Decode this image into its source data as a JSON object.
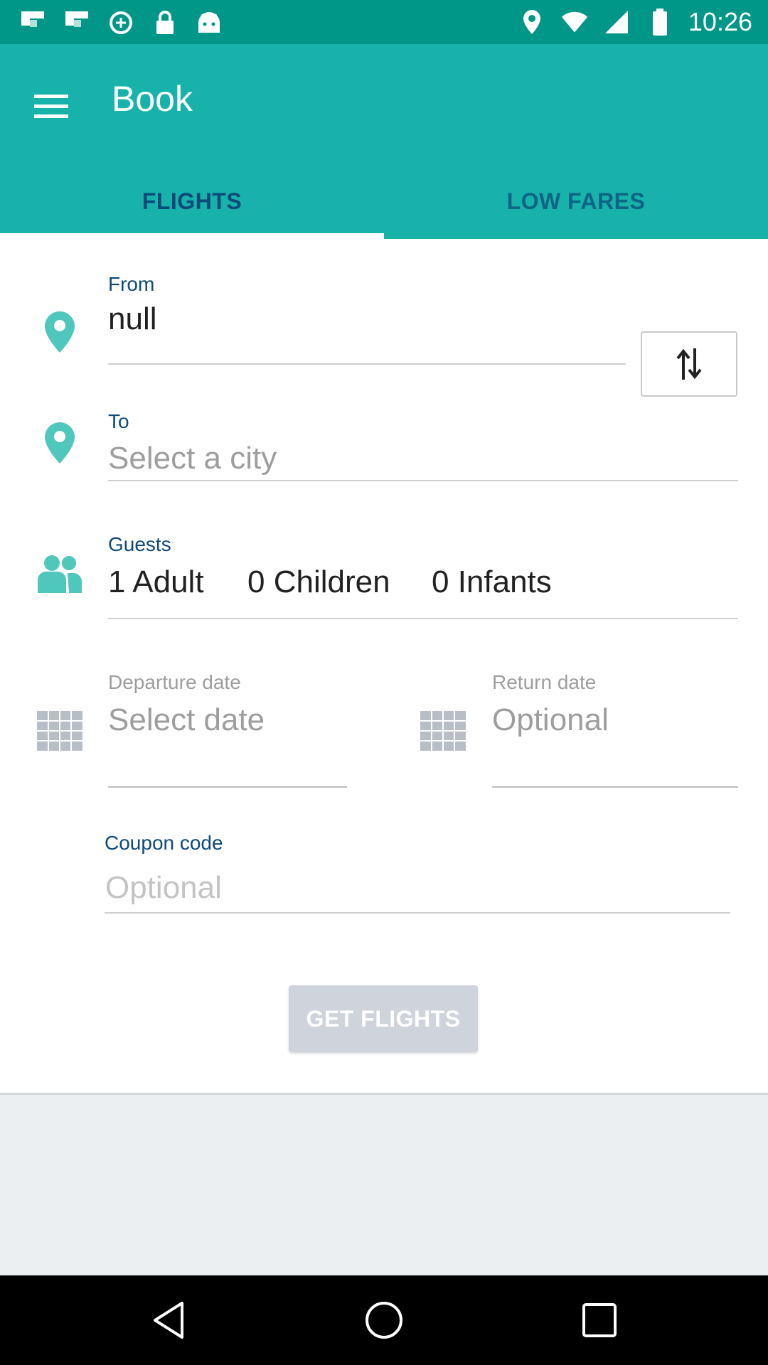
{
  "status_bar": {
    "time": "10:26",
    "left_icons": [
      "flipboard-icon",
      "flipboard-icon",
      "data-saver-icon",
      "lock-icon",
      "android-icon"
    ],
    "right_icons": [
      "location-icon",
      "wifi-icon",
      "signal-icon",
      "battery-icon"
    ]
  },
  "app_bar": {
    "title": "Book",
    "menu_icon": "menu-icon",
    "tabs": [
      {
        "label": "FLIGHTS",
        "selected": true
      },
      {
        "label": "LOW FARES",
        "selected": false
      }
    ],
    "color": "#17b3aa"
  },
  "form": {
    "from": {
      "label": "From",
      "value": "null",
      "icon": "location-pin-icon"
    },
    "swap": {
      "icon": "swap-vertical-icon"
    },
    "to": {
      "label": "To",
      "placeholder": "Select a city",
      "icon": "location-pin-icon"
    },
    "guests": {
      "label": "Guests",
      "icon": "people-icon",
      "adults": "1 Adult",
      "children": "0 Children",
      "infants": "0 Infants"
    },
    "departure": {
      "label": "Departure date",
      "placeholder": "Select date",
      "icon": "calendar-icon"
    },
    "return": {
      "label": "Return date",
      "placeholder": "Optional",
      "icon": "calendar-icon"
    },
    "coupon": {
      "label": "Coupon code",
      "placeholder": "Optional"
    },
    "submit_label": "GET FLIGHTS"
  },
  "nav_bar": {
    "buttons": [
      "back-icon",
      "home-icon",
      "recents-icon"
    ]
  }
}
